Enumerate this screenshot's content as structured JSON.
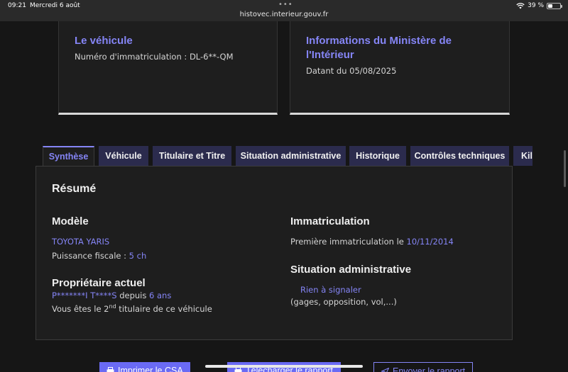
{
  "status_bar": {
    "time": "09:21",
    "date": "Mercredi 6 août",
    "url": "histovec.interieur.gouv.fr",
    "battery": "39 %",
    "battery_level": 0.39
  },
  "cards": {
    "vehicle": {
      "title": "Le véhicule",
      "text": "Numéro d'immatriculation : DL-6**-QM"
    },
    "ministry": {
      "title": "Informations du Ministère de l'Intérieur",
      "text": "Datant du 05/08/2025"
    }
  },
  "tabs": [
    {
      "label": "Synthèse",
      "active": true
    },
    {
      "label": "Véhicule",
      "active": false
    },
    {
      "label": "Titulaire et Titre",
      "active": false
    },
    {
      "label": "Situation administrative",
      "active": false
    },
    {
      "label": "Historique",
      "active": false
    },
    {
      "label": "Contrôles techniques",
      "active": false
    },
    {
      "label": "Kilométrage",
      "active": false
    }
  ],
  "summary": {
    "title": "Résumé",
    "model": {
      "heading": "Modèle",
      "name": "TOYOTA YARIS",
      "fiscal_label": "Puissance fiscale : ",
      "fiscal_value": "5 ch"
    },
    "owner": {
      "heading": "Propriétaire actuel",
      "name": "P*******I T****S",
      "since_label": " depuis ",
      "since_value": "6 ans",
      "rank_prefix": "Vous êtes le 2",
      "rank_sup": "nd",
      "rank_suffix": " titulaire de ce véhicule"
    },
    "registration": {
      "heading": "Immatriculation",
      "first_label": "Première immatriculation le ",
      "first_value": "10/11/2014"
    },
    "admin": {
      "heading": "Situation administrative",
      "status": "Rien à signaler",
      "detail": "(gages, opposition, vol,...)"
    }
  },
  "buttons": {
    "print": "Imprimer le CSA",
    "download": "Télécharger le rapport",
    "send": "Envoyer le rapport"
  },
  "colors": {
    "accent": "#8585f6",
    "tab_bg": "#2b2b4d",
    "background": "#161616",
    "card_bg": "#1e1e1e"
  }
}
